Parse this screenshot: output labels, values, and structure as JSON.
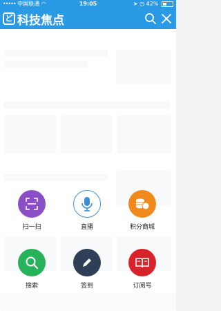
{
  "status_bar": {
    "carrier": "中国联通",
    "time": "19:05",
    "battery": "42%",
    "battery_level": 0.42
  },
  "header": {
    "logo_mark": "ど",
    "title": "科技焦点",
    "search_icon": "search-icon",
    "close_icon": "close-icon"
  },
  "actions": [
    {
      "label": "扫一扫",
      "icon": "scan-icon",
      "color": "#8a4fc7"
    },
    {
      "label": "直播",
      "icon": "microphone-icon",
      "color": "#ffffff"
    },
    {
      "label": "积分商城",
      "icon": "coins-icon",
      "color": "#f08a1c"
    },
    {
      "label": "搜索",
      "icon": "search-icon",
      "color": "#27b35a"
    },
    {
      "label": "签到",
      "icon": "pen-icon",
      "color": "#2e3f57"
    },
    {
      "label": "订阅号",
      "icon": "book-icon",
      "color": "#d9232a"
    }
  ],
  "colors": {
    "brand": "#2b9ae6"
  }
}
